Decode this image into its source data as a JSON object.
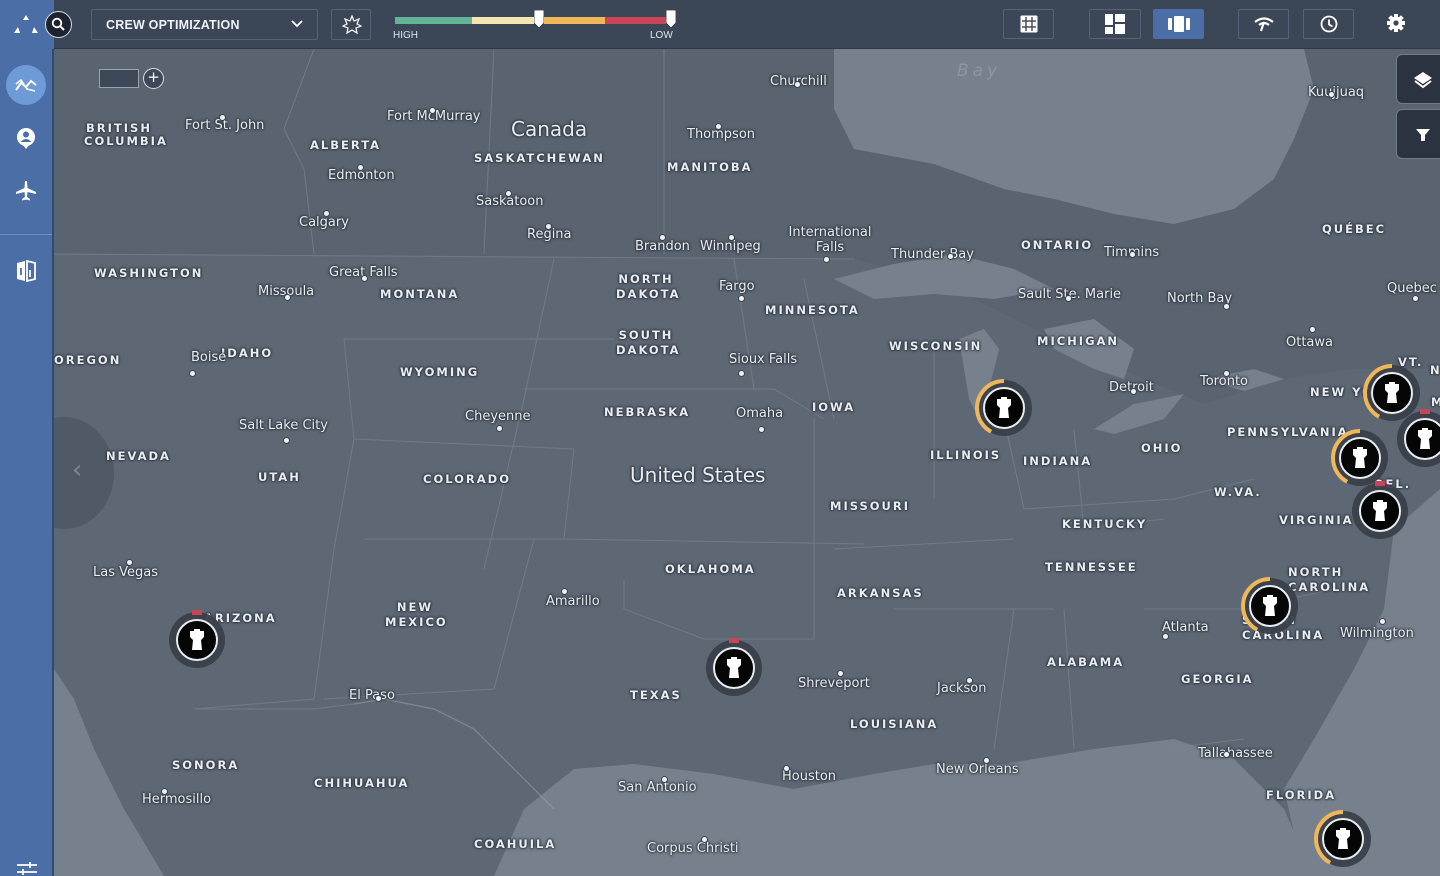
{
  "app": {
    "view_title": "CREW OPTIMIZATION"
  },
  "toolbar": {
    "icons": {
      "logo": "triangle-dots-logo",
      "search": "search-icon",
      "dropdown_chevron": "chevron-down-icon",
      "favorite": "star-icon",
      "grid": "grid-icon",
      "dashboard": "dashboard-layout-icon",
      "cards": "card-carousel-icon",
      "signal": "signal-icon",
      "history": "clock-icon",
      "settings": "gear-icon"
    },
    "priority_slider": {
      "label_high": "HIGH",
      "label_low": "LOW",
      "segments": [
        {
          "name": "high",
          "color": "#5fb595",
          "fraction": 0.28
        },
        {
          "name": "medium-high",
          "color": "#f6e4b2",
          "fraction": 0.24
        },
        {
          "name": "medium",
          "color": "#f0b75a",
          "fraction": 0.24
        },
        {
          "name": "low",
          "color": "#c84459",
          "fraction": 0.24
        }
      ],
      "handle_values": [
        0.52,
        1.0
      ]
    },
    "layout_active": "cards"
  },
  "sidebar": {
    "items": [
      {
        "name": "analytics",
        "icon": "trend-chart-icon",
        "active": true
      },
      {
        "name": "crew",
        "icon": "user-pin-icon",
        "active": false
      },
      {
        "name": "flights",
        "icon": "airplane-icon",
        "active": false
      },
      {
        "name": "compare",
        "icon": "split-view-icon",
        "active": false
      }
    ],
    "bottom_icon": "sliders-icon"
  },
  "map": {
    "zoom_plus_label": "+",
    "collapse_glyph": "‹",
    "controls": [
      {
        "name": "layers",
        "icon": "layers-icon"
      },
      {
        "name": "filter",
        "icon": "filter-icon"
      }
    ],
    "countries": [
      {
        "label": "Canada"
      },
      {
        "label": "United States"
      }
    ],
    "water": [
      {
        "label": "Bay"
      }
    ],
    "states": [
      "BRITISH COLUMBIA",
      "ALBERTA",
      "SASKATCHEWAN",
      "MANITOBA",
      "ONTARIO",
      "QUÉBEC",
      "WASHINGTON",
      "MONTANA",
      "NORTH DAKOTA",
      "MINNESOTA",
      "WISCONSIN",
      "MICHIGAN",
      "OREGON",
      "IDAHO",
      "WYOMING",
      "SOUTH DAKOTA",
      "NEBRASKA",
      "IOWA",
      "ILLINOIS",
      "INDIANA",
      "OHIO",
      "PENNSYLVANIA",
      "NEW YO",
      "VT.",
      "N",
      "M",
      "NEVADA",
      "UTAH",
      "COLORADO",
      "MISSOURI",
      "KENTUCKY",
      "W.VA.",
      "VIRGINIA",
      "DEL.",
      "TENNESSEE",
      "NORTH CAROLINA",
      "SOUTH CAROLINA",
      "ARIZONA",
      "NEW MEXICO",
      "OKLAHOMA",
      "ARKANSAS",
      "ALABAMA",
      "GEORGIA",
      "TEXAS",
      "LOUISIANA",
      "FLORIDA",
      "SONORA",
      "CHIHUAHUA",
      "COAHUILA"
    ],
    "cities": [
      "Churchill",
      "Kuujjuaq",
      "Fort McMurray",
      "Fort St. John",
      "Thompson",
      "Edmonton",
      "Saskatoon",
      "Calgary",
      "Regina",
      "Brandon",
      "Winnipeg",
      "International Falls",
      "Thunder Bay",
      "Timmins",
      "Sault Ste. Marie",
      "North Bay",
      "Quebec",
      "Ottawa",
      "Toronto",
      "Detroit",
      "Great Falls",
      "Missoula",
      "Fargo",
      "Sioux Falls",
      "Boise",
      "Cheyenne",
      "Omaha",
      "Salt Lake City",
      "Las Vegas",
      "Amarillo",
      "El Paso",
      "Shreveport",
      "Jackson",
      "Atlanta",
      "Wilmington",
      "Tallahassee",
      "New Orleans",
      "Houston",
      "San Antonio",
      "Corpus Christi",
      "Hermosillo"
    ],
    "markers": [
      {
        "id": "illinois",
        "status": "warning",
        "ring_color": "#f0b75a",
        "progress": 0.42
      },
      {
        "id": "new-york",
        "status": "warning",
        "ring_color": "#f0b75a",
        "progress": 0.42
      },
      {
        "id": "new-jersey",
        "status": "alert",
        "ring_color": "#c84459",
        "progress": 0
      },
      {
        "id": "pennsylvania",
        "status": "warning",
        "ring_color": "#f0b75a",
        "progress": 0.42
      },
      {
        "id": "delaware",
        "status": "alert",
        "ring_color": "#c84459",
        "progress": 0
      },
      {
        "id": "north-carolina",
        "status": "warning",
        "ring_color": "#f0b75a",
        "progress": 0.42
      },
      {
        "id": "florida",
        "status": "warning",
        "ring_color": "#f0b75a",
        "progress": 0.42
      },
      {
        "id": "arizona",
        "status": "alert",
        "ring_color": "#c84459",
        "progress": 0
      },
      {
        "id": "texas",
        "status": "alert",
        "ring_color": "#c84459",
        "progress": 0
      }
    ]
  }
}
